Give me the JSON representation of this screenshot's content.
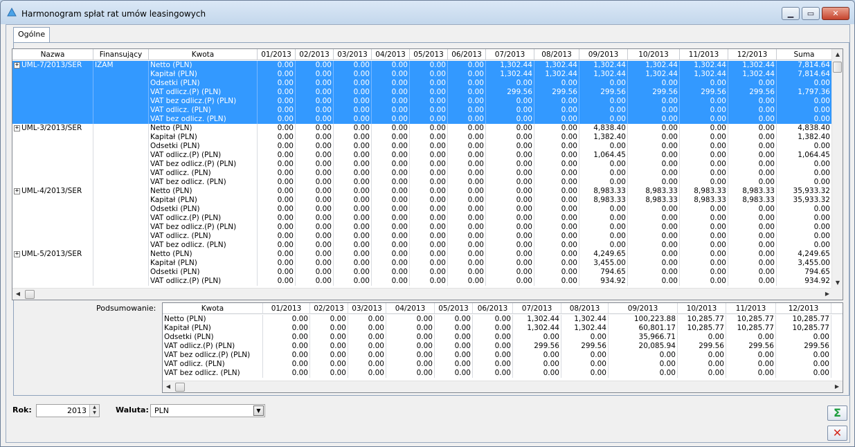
{
  "window": {
    "title": "Harmonogram spłat rat umów leasingowych",
    "min_glyph": "▁",
    "max_glyph": "▭",
    "close_glyph": "✕"
  },
  "tabs": [
    {
      "label": "Ogólne"
    }
  ],
  "main_grid": {
    "columns": [
      "Nazwa",
      "Finansujący",
      "Kwota",
      "01/2013",
      "02/2013",
      "03/2013",
      "04/2013",
      "05/2013",
      "06/2013",
      "07/2013",
      "08/2013",
      "09/2013",
      "10/2013",
      "11/2013",
      "12/2013",
      "Suma"
    ],
    "groups": [
      {
        "name": "UML-7/2013/SER",
        "financier": "IZAM",
        "selected": true,
        "rows": [
          {
            "kwota": "Netto (PLN)",
            "values": [
              "0.00",
              "0.00",
              "0.00",
              "0.00",
              "0.00",
              "0.00",
              "1,302.44",
              "1,302.44",
              "1,302.44",
              "1,302.44",
              "1,302.44",
              "1,302.44",
              "7,814.64"
            ]
          },
          {
            "kwota": "Kapitał (PLN)",
            "values": [
              "0.00",
              "0.00",
              "0.00",
              "0.00",
              "0.00",
              "0.00",
              "1,302.44",
              "1,302.44",
              "1,302.44",
              "1,302.44",
              "1,302.44",
              "1,302.44",
              "7,814.64"
            ]
          },
          {
            "kwota": "Odsetki (PLN)",
            "values": [
              "0.00",
              "0.00",
              "0.00",
              "0.00",
              "0.00",
              "0.00",
              "0.00",
              "0.00",
              "0.00",
              "0.00",
              "0.00",
              "0.00",
              "0.00"
            ]
          },
          {
            "kwota": "VAT odlicz.(P) (PLN)",
            "values": [
              "0.00",
              "0.00",
              "0.00",
              "0.00",
              "0.00",
              "0.00",
              "299.56",
              "299.56",
              "299.56",
              "299.56",
              "299.56",
              "299.56",
              "1,797.36"
            ]
          },
          {
            "kwota": "VAT bez odlicz.(P) (PLN)",
            "values": [
              "0.00",
              "0.00",
              "0.00",
              "0.00",
              "0.00",
              "0.00",
              "0.00",
              "0.00",
              "0.00",
              "0.00",
              "0.00",
              "0.00",
              "0.00"
            ]
          },
          {
            "kwota": "VAT odlicz. (PLN)",
            "values": [
              "0.00",
              "0.00",
              "0.00",
              "0.00",
              "0.00",
              "0.00",
              "0.00",
              "0.00",
              "0.00",
              "0.00",
              "0.00",
              "0.00",
              "0.00"
            ]
          },
          {
            "kwota": "VAT bez odlicz. (PLN)",
            "values": [
              "0.00",
              "0.00",
              "0.00",
              "0.00",
              "0.00",
              "0.00",
              "0.00",
              "0.00",
              "0.00",
              "0.00",
              "0.00",
              "0.00",
              "0.00"
            ]
          }
        ]
      },
      {
        "name": "UML-3/2013/SER",
        "financier": "",
        "selected": false,
        "rows": [
          {
            "kwota": "Netto (PLN)",
            "values": [
              "0.00",
              "0.00",
              "0.00",
              "0.00",
              "0.00",
              "0.00",
              "0.00",
              "0.00",
              "4,838.40",
              "0.00",
              "0.00",
              "0.00",
              "4,838.40"
            ]
          },
          {
            "kwota": "Kapitał (PLN)",
            "values": [
              "0.00",
              "0.00",
              "0.00",
              "0.00",
              "0.00",
              "0.00",
              "0.00",
              "0.00",
              "1,382.40",
              "0.00",
              "0.00",
              "0.00",
              "1,382.40"
            ]
          },
          {
            "kwota": "Odsetki (PLN)",
            "values": [
              "0.00",
              "0.00",
              "0.00",
              "0.00",
              "0.00",
              "0.00",
              "0.00",
              "0.00",
              "0.00",
              "0.00",
              "0.00",
              "0.00",
              "0.00"
            ]
          },
          {
            "kwota": "VAT odlicz.(P) (PLN)",
            "values": [
              "0.00",
              "0.00",
              "0.00",
              "0.00",
              "0.00",
              "0.00",
              "0.00",
              "0.00",
              "1,064.45",
              "0.00",
              "0.00",
              "0.00",
              "1,064.45"
            ]
          },
          {
            "kwota": "VAT bez odlicz.(P) (PLN)",
            "values": [
              "0.00",
              "0.00",
              "0.00",
              "0.00",
              "0.00",
              "0.00",
              "0.00",
              "0.00",
              "0.00",
              "0.00",
              "0.00",
              "0.00",
              "0.00"
            ]
          },
          {
            "kwota": "VAT odlicz. (PLN)",
            "values": [
              "0.00",
              "0.00",
              "0.00",
              "0.00",
              "0.00",
              "0.00",
              "0.00",
              "0.00",
              "0.00",
              "0.00",
              "0.00",
              "0.00",
              "0.00"
            ]
          },
          {
            "kwota": "VAT bez odlicz. (PLN)",
            "values": [
              "0.00",
              "0.00",
              "0.00",
              "0.00",
              "0.00",
              "0.00",
              "0.00",
              "0.00",
              "0.00",
              "0.00",
              "0.00",
              "0.00",
              "0.00"
            ]
          }
        ]
      },
      {
        "name": "UML-4/2013/SER",
        "financier": "",
        "selected": false,
        "rows": [
          {
            "kwota": "Netto (PLN)",
            "values": [
              "0.00",
              "0.00",
              "0.00",
              "0.00",
              "0.00",
              "0.00",
              "0.00",
              "0.00",
              "8,983.33",
              "8,983.33",
              "8,983.33",
              "8,983.33",
              "35,933.32"
            ]
          },
          {
            "kwota": "Kapitał (PLN)",
            "values": [
              "0.00",
              "0.00",
              "0.00",
              "0.00",
              "0.00",
              "0.00",
              "0.00",
              "0.00",
              "8,983.33",
              "8,983.33",
              "8,983.33",
              "8,983.33",
              "35,933.32"
            ]
          },
          {
            "kwota": "Odsetki (PLN)",
            "values": [
              "0.00",
              "0.00",
              "0.00",
              "0.00",
              "0.00",
              "0.00",
              "0.00",
              "0.00",
              "0.00",
              "0.00",
              "0.00",
              "0.00",
              "0.00"
            ]
          },
          {
            "kwota": "VAT odlicz.(P) (PLN)",
            "values": [
              "0.00",
              "0.00",
              "0.00",
              "0.00",
              "0.00",
              "0.00",
              "0.00",
              "0.00",
              "0.00",
              "0.00",
              "0.00",
              "0.00",
              "0.00"
            ]
          },
          {
            "kwota": "VAT bez odlicz.(P) (PLN)",
            "values": [
              "0.00",
              "0.00",
              "0.00",
              "0.00",
              "0.00",
              "0.00",
              "0.00",
              "0.00",
              "0.00",
              "0.00",
              "0.00",
              "0.00",
              "0.00"
            ]
          },
          {
            "kwota": "VAT odlicz. (PLN)",
            "values": [
              "0.00",
              "0.00",
              "0.00",
              "0.00",
              "0.00",
              "0.00",
              "0.00",
              "0.00",
              "0.00",
              "0.00",
              "0.00",
              "0.00",
              "0.00"
            ]
          },
          {
            "kwota": "VAT bez odlicz. (PLN)",
            "values": [
              "0.00",
              "0.00",
              "0.00",
              "0.00",
              "0.00",
              "0.00",
              "0.00",
              "0.00",
              "0.00",
              "0.00",
              "0.00",
              "0.00",
              "0.00"
            ]
          }
        ]
      },
      {
        "name": "UML-5/2013/SER",
        "financier": "",
        "selected": false,
        "rows": [
          {
            "kwota": "Netto (PLN)",
            "values": [
              "0.00",
              "0.00",
              "0.00",
              "0.00",
              "0.00",
              "0.00",
              "0.00",
              "0.00",
              "4,249.65",
              "0.00",
              "0.00",
              "0.00",
              "4,249.65"
            ]
          },
          {
            "kwota": "Kapitał (PLN)",
            "values": [
              "0.00",
              "0.00",
              "0.00",
              "0.00",
              "0.00",
              "0.00",
              "0.00",
              "0.00",
              "3,455.00",
              "0.00",
              "0.00",
              "0.00",
              "3,455.00"
            ]
          },
          {
            "kwota": "Odsetki (PLN)",
            "values": [
              "0.00",
              "0.00",
              "0.00",
              "0.00",
              "0.00",
              "0.00",
              "0.00",
              "0.00",
              "794.65",
              "0.00",
              "0.00",
              "0.00",
              "794.65"
            ]
          },
          {
            "kwota": "VAT odlicz.(P) (PLN)",
            "values": [
              "0.00",
              "0.00",
              "0.00",
              "0.00",
              "0.00",
              "0.00",
              "0.00",
              "0.00",
              "934.92",
              "0.00",
              "0.00",
              "0.00",
              "934.92"
            ]
          }
        ]
      }
    ]
  },
  "summary": {
    "label": "Podsumowanie:",
    "columns": [
      "Kwota",
      "01/2013",
      "02/2013",
      "03/2013",
      "04/2013",
      "05/2013",
      "06/2013",
      "07/2013",
      "08/2013",
      "09/2013",
      "10/2013",
      "11/2013",
      "12/2013"
    ],
    "rows": [
      {
        "kwota": "Netto (PLN)",
        "values": [
          "0.00",
          "0.00",
          "0.00",
          "0.00",
          "0.00",
          "0.00",
          "1,302.44",
          "1,302.44",
          "100,223.88",
          "10,285.77",
          "10,285.77",
          "10,285.77"
        ]
      },
      {
        "kwota": "Kapitał (PLN)",
        "values": [
          "0.00",
          "0.00",
          "0.00",
          "0.00",
          "0.00",
          "0.00",
          "1,302.44",
          "1,302.44",
          "60,801.17",
          "10,285.77",
          "10,285.77",
          "10,285.77"
        ]
      },
      {
        "kwota": "Odsetki (PLN)",
        "values": [
          "0.00",
          "0.00",
          "0.00",
          "0.00",
          "0.00",
          "0.00",
          "0.00",
          "0.00",
          "35,966.71",
          "0.00",
          "0.00",
          "0.00"
        ]
      },
      {
        "kwota": "VAT odlicz.(P) (PLN)",
        "values": [
          "0.00",
          "0.00",
          "0.00",
          "0.00",
          "0.00",
          "0.00",
          "299.56",
          "299.56",
          "20,085.94",
          "299.56",
          "299.56",
          "299.56"
        ]
      },
      {
        "kwota": "VAT bez odlicz.(P) (PLN)",
        "values": [
          "0.00",
          "0.00",
          "0.00",
          "0.00",
          "0.00",
          "0.00",
          "0.00",
          "0.00",
          "0.00",
          "0.00",
          "0.00",
          "0.00"
        ]
      },
      {
        "kwota": "VAT odlicz. (PLN)",
        "values": [
          "0.00",
          "0.00",
          "0.00",
          "0.00",
          "0.00",
          "0.00",
          "0.00",
          "0.00",
          "0.00",
          "0.00",
          "0.00",
          "0.00"
        ]
      },
      {
        "kwota": "VAT bez odlicz. (PLN)",
        "values": [
          "0.00",
          "0.00",
          "0.00",
          "0.00",
          "0.00",
          "0.00",
          "0.00",
          "0.00",
          "0.00",
          "0.00",
          "0.00",
          "0.00"
        ]
      }
    ]
  },
  "footer": {
    "year_label": "Rok:",
    "year_value": "2013",
    "currency_label": "Waluta:",
    "currency_value": "PLN",
    "sum_button_glyph": "Σ",
    "close_button_glyph": "✕"
  },
  "colors": {
    "selection": "#3399ff",
    "sum_button": "#1a9c3c",
    "close_button": "#d4281c"
  },
  "icons": [
    "app-icon",
    "expand-plus-icon",
    "sigma-icon",
    "close-x-icon"
  ]
}
